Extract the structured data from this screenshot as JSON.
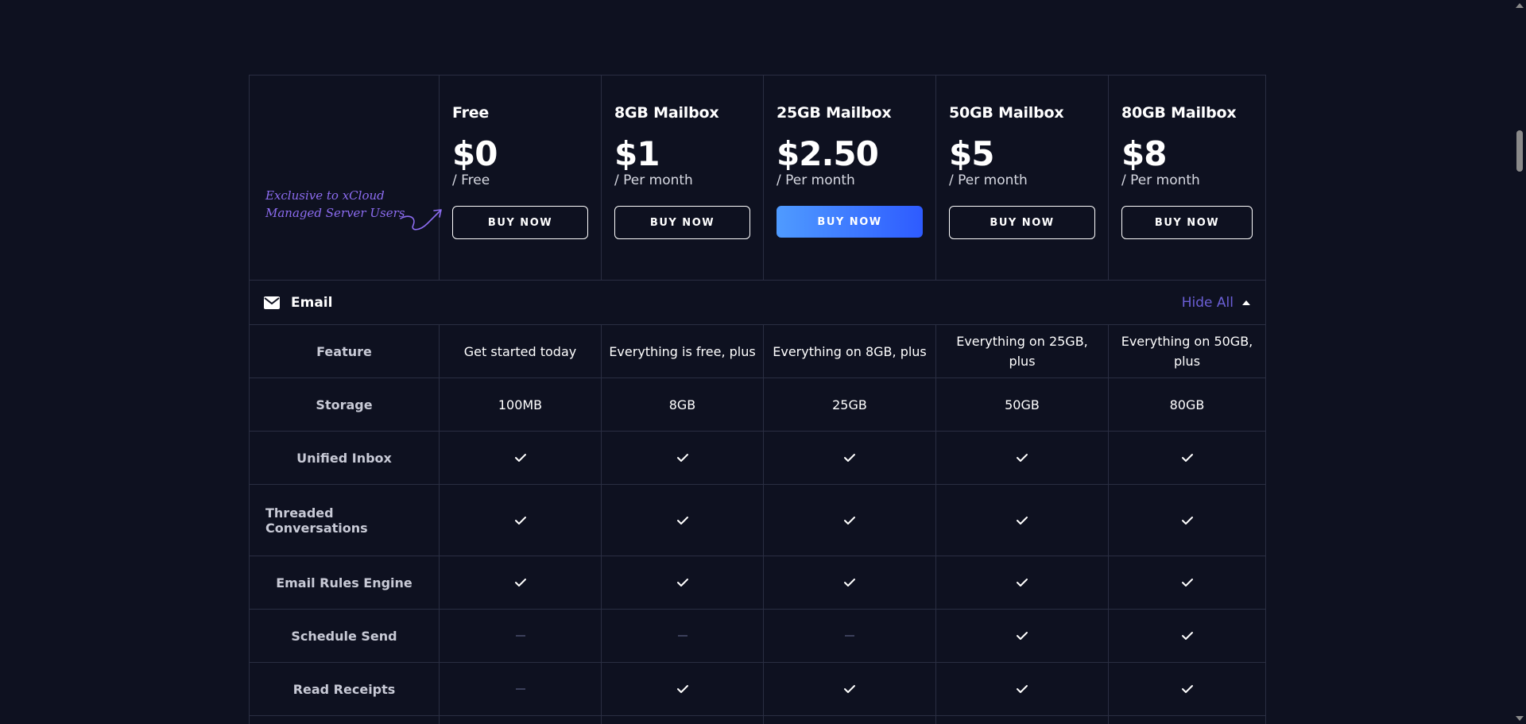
{
  "note": {
    "line1": "Exclusive to xCloud",
    "line2": "Managed Server Users",
    "color": "#8c6cf0"
  },
  "plans": [
    {
      "name": "Free",
      "price": "$0",
      "period": "/ Free",
      "button": "BUY NOW",
      "featured": false
    },
    {
      "name": "8GB Mailbox",
      "price": "$1",
      "period": "/ Per month",
      "button": "BUY NOW",
      "featured": false
    },
    {
      "name": "25GB Mailbox",
      "price": "$2.50",
      "period": "/ Per month",
      "button": "BUY NOW",
      "featured": true
    },
    {
      "name": "50GB Mailbox",
      "price": "$5",
      "period": "/ Per month",
      "button": "BUY NOW",
      "featured": false
    },
    {
      "name": "80GB Mailbox",
      "price": "$8",
      "period": "/ Per month",
      "button": "BUY NOW",
      "featured": false
    }
  ],
  "section": {
    "title": "Email",
    "icon": "mail-icon",
    "toggle_label": "Hide All",
    "toggle_icon": "caret-up-icon"
  },
  "features": [
    {
      "label": "Feature",
      "align": "center",
      "values": [
        "Get started today",
        "Everything is free, plus",
        "Everything on 8GB, plus",
        "Everything on 25GB, plus",
        "Everything on 50GB, plus"
      ]
    },
    {
      "label": "Storage",
      "align": "center",
      "values": [
        "100MB",
        "8GB",
        "25GB",
        "50GB",
        "80GB"
      ]
    },
    {
      "label": "Unified Inbox",
      "align": "center",
      "values": [
        "check",
        "check",
        "check",
        "check",
        "check"
      ]
    },
    {
      "label": "Threaded Conversations",
      "align": "left",
      "values": [
        "check",
        "check",
        "check",
        "check",
        "check"
      ]
    },
    {
      "label": "Email Rules Engine",
      "align": "center",
      "values": [
        "check",
        "check",
        "check",
        "check",
        "check"
      ]
    },
    {
      "label": "Schedule Send",
      "align": "center",
      "values": [
        "dash",
        "dash",
        "dash",
        "check",
        "check"
      ]
    },
    {
      "label": "Read Receipts",
      "align": "center",
      "values": [
        "dash",
        "check",
        "check",
        "check",
        "check"
      ]
    },
    {
      "label": "",
      "align": "center",
      "values": [
        "",
        "",
        "",
        "",
        ""
      ]
    }
  ],
  "colors": {
    "background": "#0e1120",
    "border": "#2a2e42",
    "accent": "#6b5fd6",
    "button_gradient_start": "#4f9bff",
    "button_gradient_end": "#2e5bff"
  }
}
